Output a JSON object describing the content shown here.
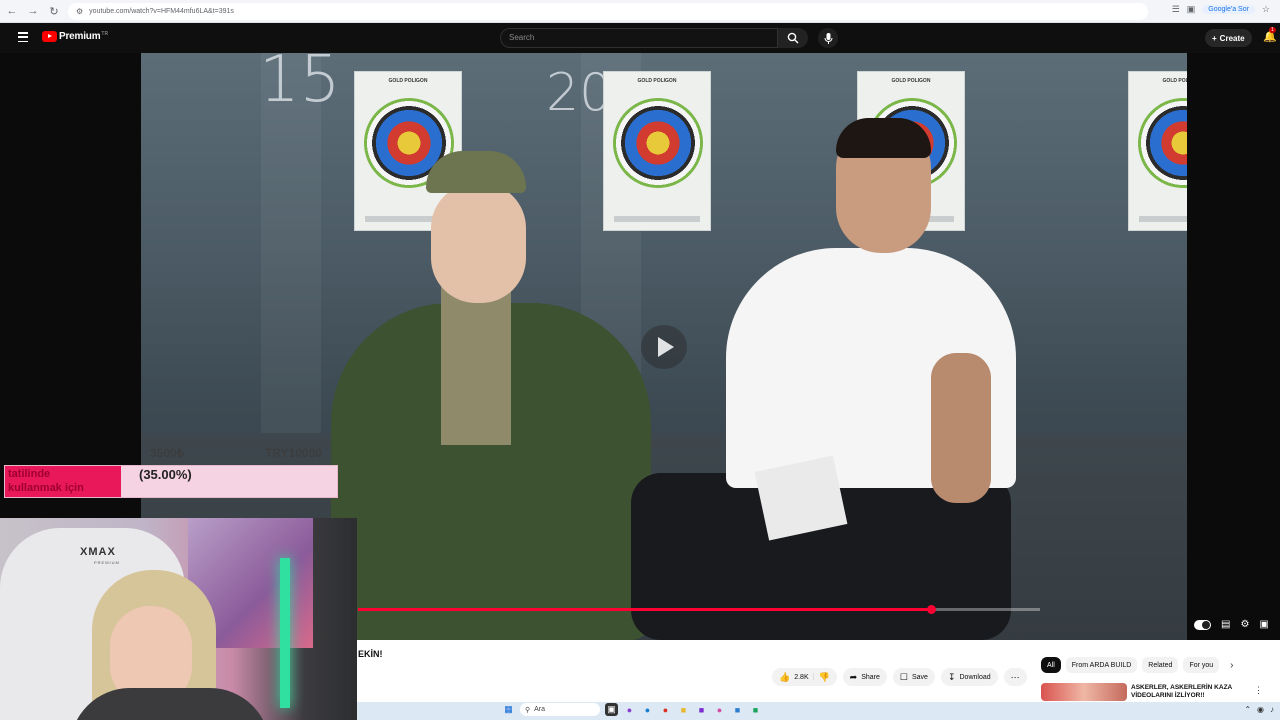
{
  "browser": {
    "url": "youtube.com/watch?v=HFM44mfu6LA&t=391s",
    "ask_button": "Google'a Sor",
    "nav": [
      "back-icon",
      "forward-icon",
      "reload-icon"
    ]
  },
  "header": {
    "logo_text": "Premium",
    "logo_region": "TR",
    "search_placeholder": "Search",
    "create_label": "Create",
    "notification_count": "1"
  },
  "overlay": {
    "donation_left_amount": "3500₺",
    "donation_right_amount": "TRY10000",
    "donation_text_line1": "tatilinde",
    "donation_text_line2": "kullanmak için",
    "donation_percent": "(35.00%)",
    "donation_progress": 0.35,
    "webcam_chair_brand": "XMAX",
    "webcam_chair_sub": "PREMIUM"
  },
  "video": {
    "lane_numbers": [
      "15",
      "20"
    ],
    "target_header": "GOLD POLIGON",
    "progress_fraction": 0.84,
    "colors": {
      "progress": "#ff0033"
    }
  },
  "info": {
    "title_fragment": "EKİN!",
    "actions": [
      {
        "icon": "like-icon",
        "label": "2.8K"
      },
      {
        "icon": "dislike-icon",
        "label": ""
      },
      {
        "icon": "share-icon",
        "label": "Share"
      },
      {
        "icon": "save-icon",
        "label": "Save"
      },
      {
        "icon": "download-icon",
        "label": "Download"
      }
    ],
    "chips": [
      "All",
      "From ARDA BUILD",
      "Related",
      "For you"
    ],
    "recommended_title": "ASKERLER, ASKERLERİN KAZA VİDEOLARINI İZLİYOR!!"
  },
  "taskbar": {
    "search_placeholder": "Ara"
  }
}
